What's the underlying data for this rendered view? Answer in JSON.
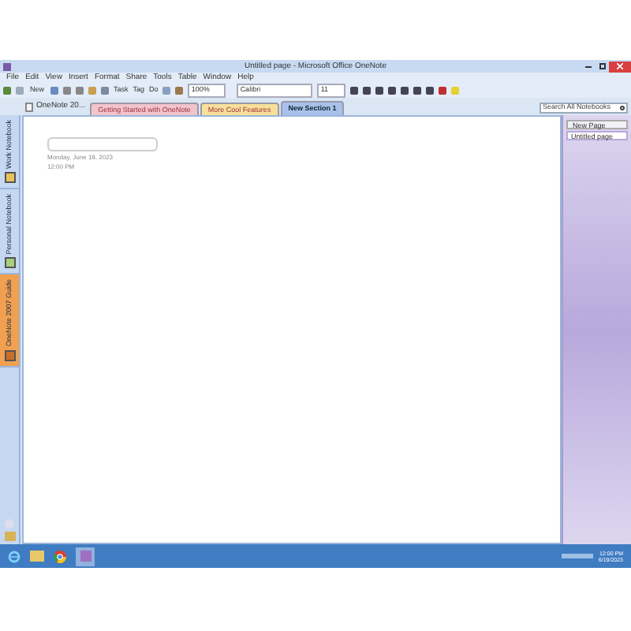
{
  "window": {
    "title": "Untitled page - Microsoft Office OneNote"
  },
  "menu_bar": [
    "File",
    "Edit",
    "View",
    "Insert",
    "Format",
    "Share",
    "Tools",
    "Table",
    "Window",
    "Help"
  ],
  "toolbar": {
    "new_button": "New",
    "task_button": "Task",
    "tag_button": "Tag",
    "do_button": "Do",
    "zoom": "100%",
    "font": "Calibri",
    "font_size": "11"
  },
  "notebook_title": "OneNote 20...",
  "sections": [
    {
      "label": "Getting Started with OneNote",
      "selected": false,
      "color": "#f2c4cc"
    },
    {
      "label": "More Cool Features",
      "selected": false,
      "color": "#f8e09a"
    },
    {
      "label": "New Section 1",
      "selected": true,
      "color": "#a9c1ea"
    }
  ],
  "search": {
    "placeholder": "Search All Notebooks"
  },
  "notebooks": [
    {
      "label": "Work Notebook",
      "selected": false,
      "color": "#e8c25a"
    },
    {
      "label": "Personal Notebook",
      "selected": false,
      "color": "#a8d07a"
    },
    {
      "label": "OneNote 2007 Guide",
      "selected": true,
      "color": "#c8702a"
    }
  ],
  "page": {
    "date": "Monday, June 19, 2023",
    "time": "12:00 PM"
  },
  "page_list": {
    "new_page_button": "New Page",
    "pages": [
      {
        "title": "Untitled page",
        "selected": true
      }
    ]
  },
  "taskbar": {
    "time": "12:00 PM",
    "date": "6/19/2023"
  }
}
